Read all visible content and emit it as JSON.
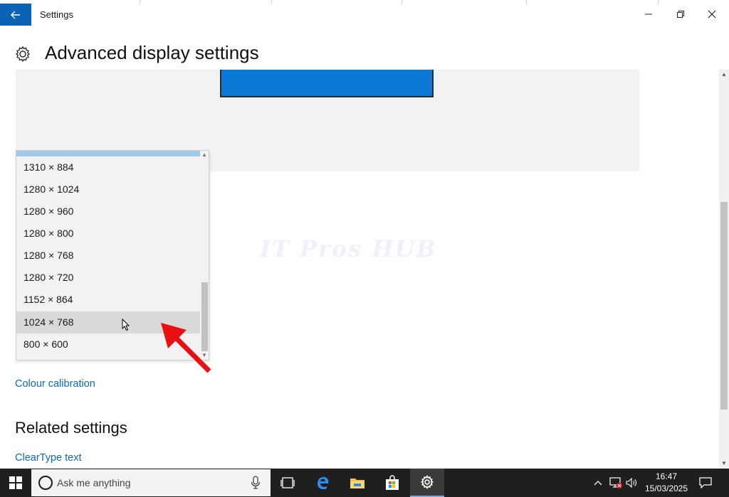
{
  "window": {
    "app_title": "Settings",
    "page_title": "Advanced display settings"
  },
  "resolution_dropdown": {
    "options": [
      "1310 × 884",
      "1280 × 1024",
      "1280 × 960",
      "1280 × 800",
      "1280 × 768",
      "1280 × 720",
      "1152 × 864",
      "1024 × 768",
      "800 × 600"
    ],
    "highlighted": "1024 × 768"
  },
  "watermark": "IT Pros HUB",
  "links": {
    "colour_calibration": "Colour calibration",
    "cleartype_text": "ClearType text"
  },
  "sections": {
    "related_settings": "Related settings"
  },
  "taskbar": {
    "search_placeholder": "Ask me anything",
    "clock_time": "16:47",
    "clock_date": "15/03/2025"
  },
  "colors": {
    "accent": "#0b63b6",
    "monitor": "#0b78d7",
    "link": "#0b6bb5",
    "annotation_arrow": "#e81010"
  }
}
